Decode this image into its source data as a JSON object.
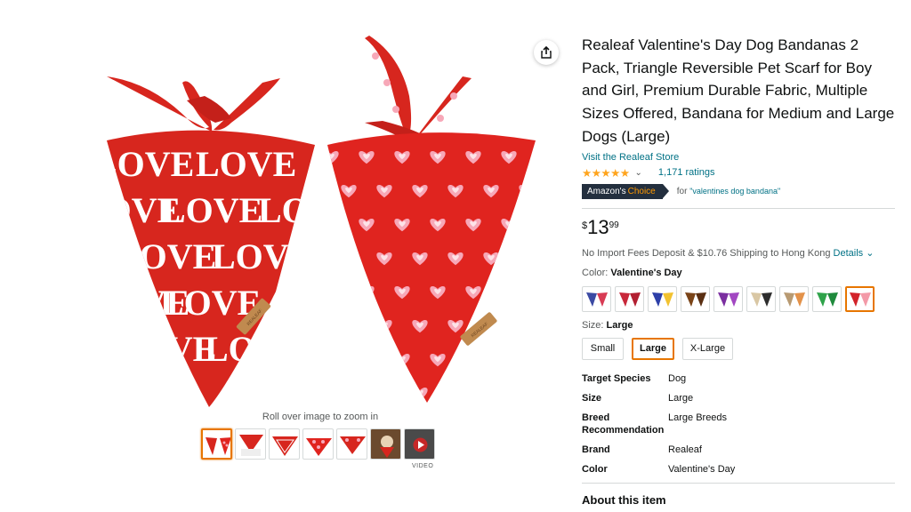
{
  "product": {
    "title": "Realeaf Valentine's Day Dog Bandanas 2 Pack, Triangle Reversible Pet Scarf for Boy and Girl, Premium Durable Fabric, Multiple Sizes Offered, Bandana for Medium and Large Dogs (Large)",
    "store_link": "Visit the Realeaf Store",
    "stars_glyphs": "★★★★★",
    "ratings": "1,171 ratings",
    "badge_prefix": "Amazon's",
    "badge_suffix": "Choice",
    "for_label": "for",
    "for_query": "\"valentines dog bandana\"",
    "price_symbol": "$",
    "price_whole": "13",
    "price_fraction": "99",
    "shipping_text": "No Import Fees Deposit & $10.76 Shipping to Hong Kong",
    "details_link": "Details",
    "color_label": "Color:",
    "color_value": "Valentine's Day",
    "size_label": "Size:",
    "size_value": "Large",
    "sizes": [
      "Small",
      "Large",
      "X-Large"
    ],
    "specs": [
      {
        "key": "Target Species",
        "value": "Dog"
      },
      {
        "key": "Size",
        "value": "Large"
      },
      {
        "key": "Breed Recommendation",
        "value": "Large Breeds"
      },
      {
        "key": "Brand",
        "value": "Realeaf"
      },
      {
        "key": "Color",
        "value": "Valentine's Day"
      }
    ],
    "about_heading": "About this item"
  },
  "gallery": {
    "zoom_hint": "Roll over image to zoom in",
    "video_label": "VIDEO",
    "main_image_text": "LOVE",
    "logo_text": "REALEAF"
  },
  "swatch_colors": [
    [
      "#3b4aa3",
      "#d83b54"
    ],
    [
      "#c8283a",
      "#b21f31"
    ],
    [
      "#2d3fa8",
      "#f2c230"
    ],
    [
      "#7a4418",
      "#5a2f12"
    ],
    [
      "#7b2fa0",
      "#a247c2"
    ],
    [
      "#d9c7a4",
      "#2d2d2d"
    ],
    [
      "#b89a72",
      "#e3924a"
    ],
    [
      "#2fa34a",
      "#1f8a3c"
    ],
    [
      "#d2232a",
      "#f39aa8"
    ]
  ],
  "colors": {
    "accent": "#e77600",
    "link": "#007185",
    "star": "#ffa41c",
    "bandana_red": "#d7261e",
    "heart_pink": "#f7a8b8"
  }
}
